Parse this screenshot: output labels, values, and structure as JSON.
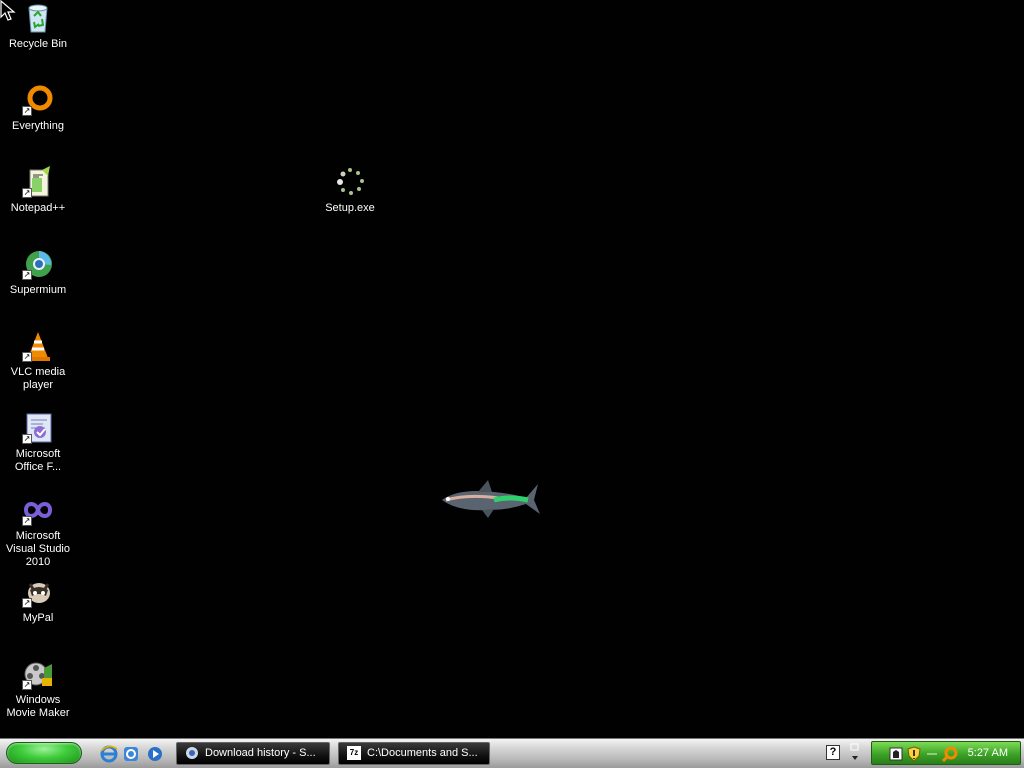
{
  "desktop": {
    "icons": [
      {
        "label": "Recycle Bin",
        "icon": "recycle-bin-icon"
      },
      {
        "label": "Everything",
        "icon": "everything-icon"
      },
      {
        "label": "Notepad++",
        "icon": "notepadpp-icon"
      },
      {
        "label": "Supermium",
        "icon": "supermium-icon"
      },
      {
        "label": "VLC media player",
        "icon": "vlc-icon"
      },
      {
        "label": "Microsoft Office F...",
        "icon": "office-icon"
      },
      {
        "label": "Microsoft Visual Studio 2010",
        "icon": "visual-studio-icon"
      },
      {
        "label": "MyPal",
        "icon": "mypal-icon"
      },
      {
        "label": "Windows Movie Maker",
        "icon": "movie-maker-icon"
      },
      {
        "label": "Setup.exe",
        "icon": "setup-loading-icon"
      }
    ]
  },
  "taskbar": {
    "quick_launch": [
      "internet-explorer-icon",
      "ie-alt-icon",
      "media-player-icon"
    ],
    "tasks": [
      {
        "label": "Download history - S...",
        "icon": "browser-icon"
      },
      {
        "label": "C:\\Documents and S...",
        "icon": "7zip-icon",
        "icon_text": "7z"
      }
    ],
    "help_glyph": "?",
    "tray_icons": [
      "network-icon",
      "security-shield-icon",
      "search-tray-icon"
    ],
    "clock": "5:27 AM"
  },
  "colors": {
    "desktop_bg": "#010101",
    "tray_green": "#3da327",
    "start_green": "#3fcc3a"
  }
}
